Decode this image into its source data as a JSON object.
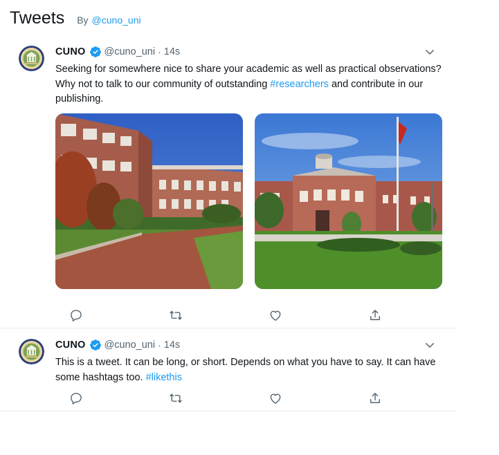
{
  "header": {
    "title": "Tweets",
    "by_label": "By",
    "handle": "@cuno_uni"
  },
  "colors": {
    "accent": "#1d9bf0",
    "text": "#0f1419",
    "muted": "#536471",
    "divider": "#e6ecf0"
  },
  "tweets": [
    {
      "name": "CUNO",
      "handle": "@cuno_uni",
      "separator": "·",
      "time": "14s",
      "text_parts": [
        "Seeking for somewhere nice to share your academic as well as practical observations? Why not to talk to our community of outstanding ",
        "#researchers",
        " and contribute in our publishing."
      ],
      "media": [
        "campus-building-photo",
        "campus-rotunda-flag-photo"
      ],
      "icons": [
        "reply-icon",
        "retweet-icon",
        "like-icon",
        "share-icon"
      ]
    },
    {
      "name": "CUNO",
      "handle": "@cuno_uni",
      "separator": "·",
      "time": "14s",
      "text_parts": [
        "This is a tweet. It can be long, or short. Depends on what you have to say. It can have some hashtags too. ",
        "#likethis"
      ],
      "icons": [
        "reply-icon",
        "retweet-icon",
        "like-icon",
        "share-icon"
      ]
    }
  ]
}
